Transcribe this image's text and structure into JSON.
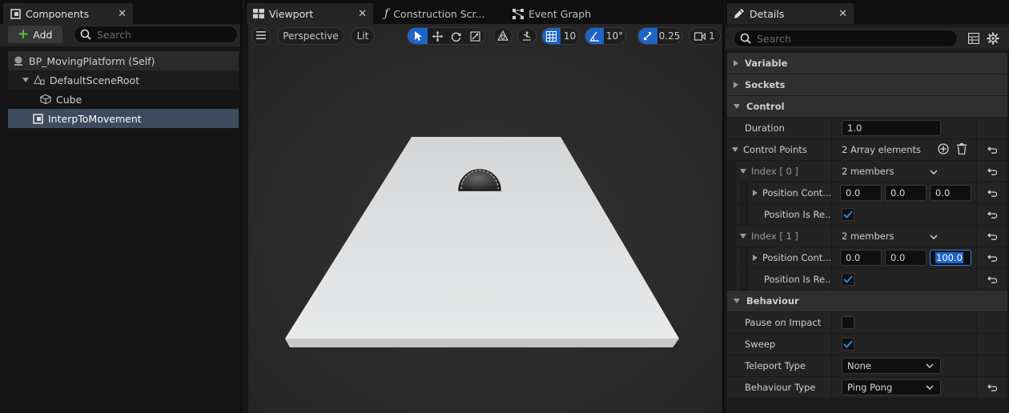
{
  "components_panel": {
    "tab_label": "Components",
    "add_label": "Add",
    "search_placeholder": "Search",
    "tree": {
      "self": "BP_MovingPlatform (Self)",
      "root": "DefaultSceneRoot",
      "cube": "Cube",
      "interp": "InterpToMovement"
    }
  },
  "viewport_panel": {
    "tabs": {
      "viewport": "Viewport",
      "construction": "Construction Scr...",
      "event_graph": "Event Graph"
    },
    "toolbar": {
      "perspective": "Perspective",
      "lit": "Lit",
      "grid_snap": "10",
      "angle_snap": "10°",
      "scale_snap": "0.25",
      "camera_speed": "1"
    }
  },
  "details_panel": {
    "tab_label": "Details",
    "search_placeholder": "Search",
    "categories": {
      "variable": "Variable",
      "sockets": "Sockets",
      "control": "Control",
      "behaviour": "Behaviour"
    },
    "control": {
      "duration_label": "Duration",
      "duration_value": "1.0",
      "control_points_label": "Control Points",
      "control_points_value": "2 Array elements",
      "index0_label": "Index [ 0 ]",
      "index0_value": "2 members",
      "index0_pos_label": "Position Cont...",
      "index0_pos": [
        "0.0",
        "0.0",
        "0.0"
      ],
      "index0_rel_label": "Position Is Re...",
      "index1_label": "Index [ 1 ]",
      "index1_value": "2 members",
      "index1_pos_label": "Position Cont...",
      "index1_pos": [
        "0.0",
        "0.0",
        "100.0"
      ],
      "index1_rel_label": "Position Is Re..."
    },
    "behaviour": {
      "pause_label": "Pause on Impact",
      "sweep_label": "Sweep",
      "teleport_label": "Teleport Type",
      "teleport_value": "None",
      "behaviour_type_label": "Behaviour Type",
      "behaviour_type_value": "Ping Pong"
    }
  }
}
